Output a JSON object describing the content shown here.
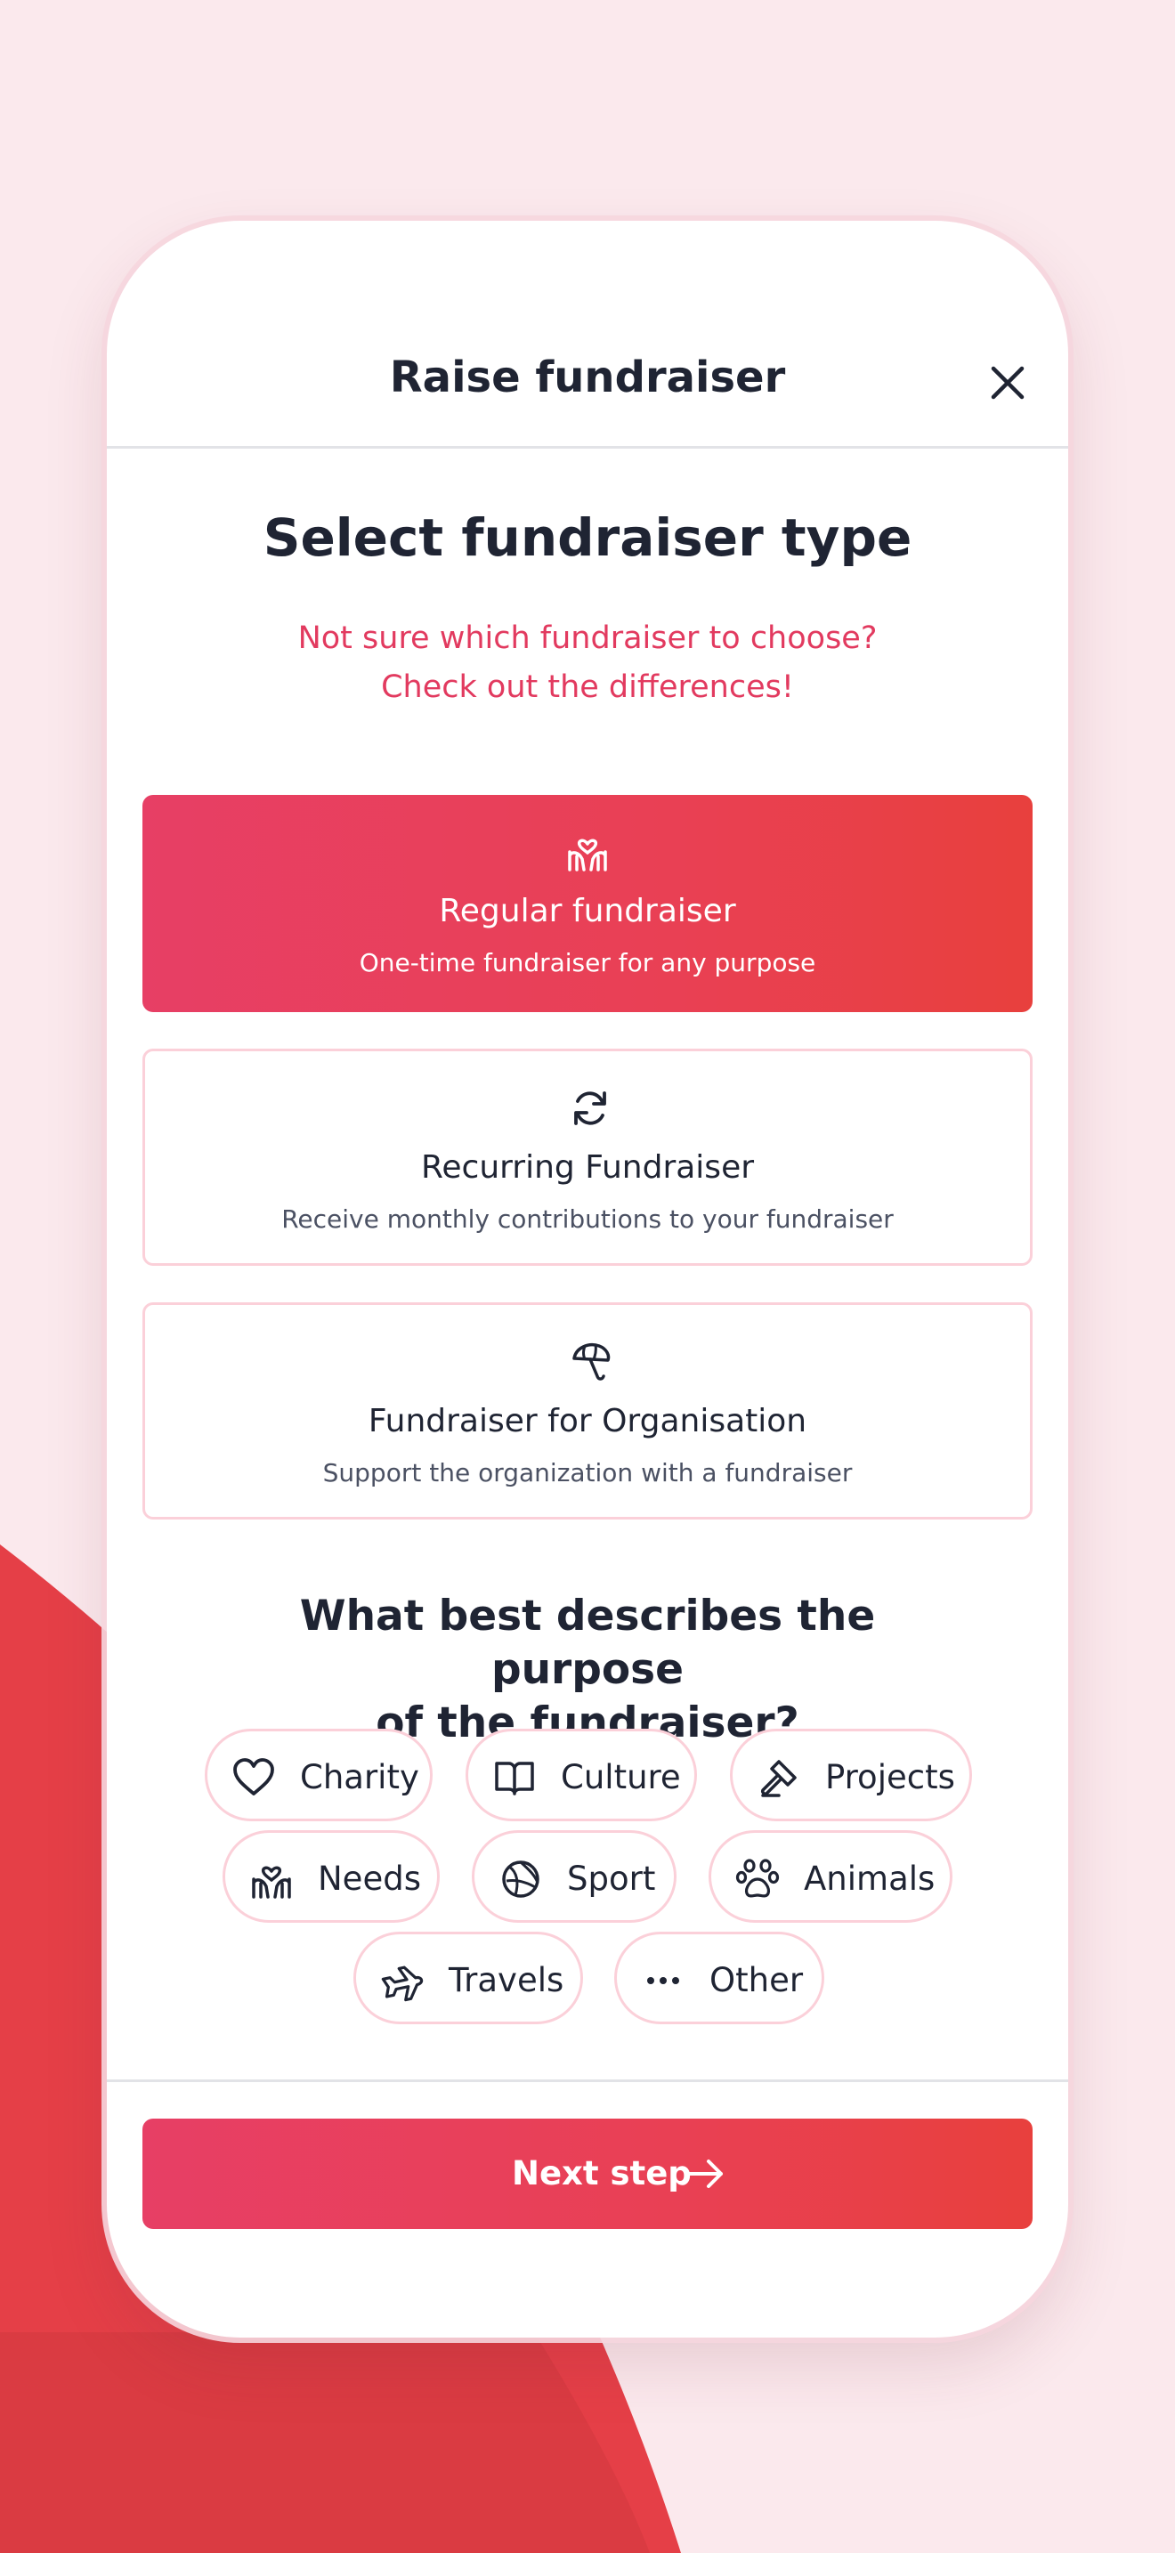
{
  "colors": {
    "accent": "#e8405a",
    "background": "#fbe9ed",
    "chip_border": "#fbd0d9",
    "text": "#1f2433"
  },
  "header": {
    "title": "Raise fundraiser",
    "close_icon": "close-icon"
  },
  "type_section": {
    "title": "Select fundraiser type",
    "help_line1": "Not sure which fundraiser to choose?",
    "help_line2": "Check out the differences!"
  },
  "fundraiser_types": [
    {
      "title": "Regular fundraiser",
      "description": "One-time fundraiser for any purpose",
      "icon": "hands-heart-icon",
      "selected": true
    },
    {
      "title": "Recurring Fundraiser",
      "description": "Receive monthly contributions to your fundraiser",
      "icon": "refresh-icon",
      "selected": false
    },
    {
      "title": "Fundraiser for Organisation",
      "description": "Support the organization with a fundraiser",
      "icon": "umbrella-icon",
      "selected": false
    }
  ],
  "purpose": {
    "title_line1": "What best describes the purpose",
    "title_line2": "of the fundraiser?",
    "categories": [
      {
        "label": "Charity",
        "icon": "heart-icon"
      },
      {
        "label": "Culture",
        "icon": "book-icon"
      },
      {
        "label": "Projects",
        "icon": "hammer-icon"
      },
      {
        "label": "Needs",
        "icon": "hands-heart-icon"
      },
      {
        "label": "Sport",
        "icon": "ball-icon"
      },
      {
        "label": "Animals",
        "icon": "paw-icon"
      },
      {
        "label": "Travels",
        "icon": "plane-icon"
      },
      {
        "label": "Other",
        "icon": "more-icon"
      }
    ]
  },
  "footer": {
    "next_label": "Next step",
    "next_icon": "arrow-right-icon"
  }
}
